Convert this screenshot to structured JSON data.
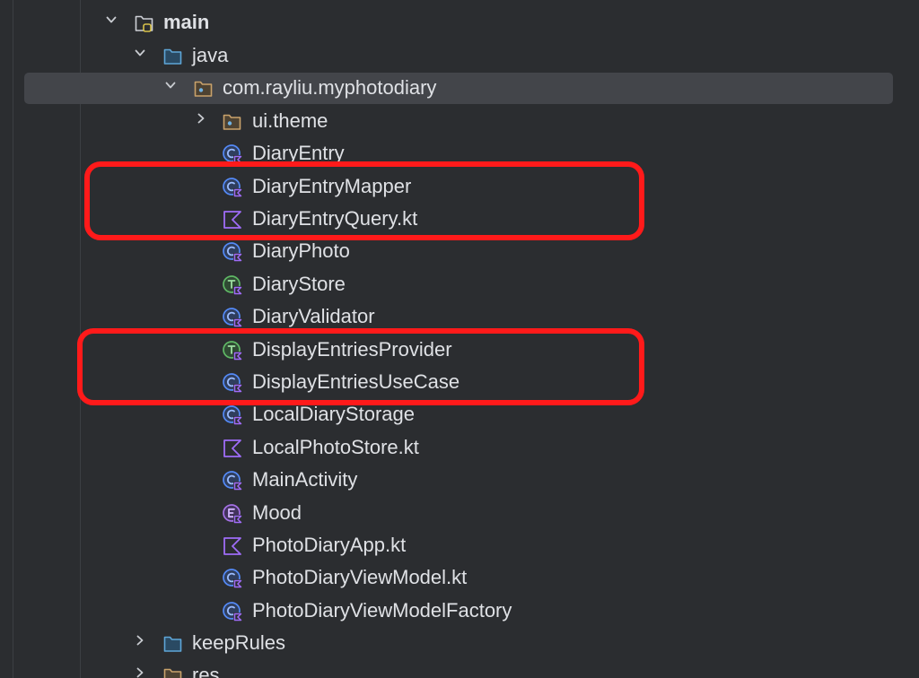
{
  "tree": {
    "rows": [
      {
        "label": "main",
        "icon": "module-folder-icon",
        "expanded": true,
        "bold": true
      },
      {
        "label": "java",
        "icon": "source-folder-icon",
        "expanded": true
      },
      {
        "label": "com.rayliu.myphotodiary",
        "icon": "package-icon",
        "expanded": true,
        "selected": true
      },
      {
        "label": "ui.theme",
        "icon": "package-icon",
        "expanded": false
      },
      {
        "label": "DiaryEntry",
        "icon": "kotlin-class-icon"
      },
      {
        "label": "DiaryEntryMapper",
        "icon": "kotlin-class-icon"
      },
      {
        "label": "DiaryEntryQuery.kt",
        "icon": "kotlin-file-icon"
      },
      {
        "label": "DiaryPhoto",
        "icon": "kotlin-class-icon"
      },
      {
        "label": "DiaryStore",
        "icon": "kotlin-interface-icon"
      },
      {
        "label": "DiaryValidator",
        "icon": "kotlin-class-icon"
      },
      {
        "label": "DisplayEntriesProvider",
        "icon": "kotlin-interface-icon"
      },
      {
        "label": "DisplayEntriesUseCase",
        "icon": "kotlin-class-icon"
      },
      {
        "label": "LocalDiaryStorage",
        "icon": "kotlin-class-icon"
      },
      {
        "label": "LocalPhotoStore.kt",
        "icon": "kotlin-file-icon"
      },
      {
        "label": "MainActivity",
        "icon": "kotlin-class-icon"
      },
      {
        "label": "Mood",
        "icon": "kotlin-enum-icon"
      },
      {
        "label": "PhotoDiaryApp.kt",
        "icon": "kotlin-file-icon"
      },
      {
        "label": "PhotoDiaryViewModel.kt",
        "icon": "kotlin-class-icon"
      },
      {
        "label": "PhotoDiaryViewModelFactory",
        "icon": "kotlin-class-icon"
      },
      {
        "label": "keepRules",
        "icon": "source-folder-icon",
        "expanded": false
      },
      {
        "label": "res",
        "icon": "resource-folder-icon",
        "expanded": false
      }
    ]
  },
  "colors": {
    "background": "#2b2d30",
    "selection": "#43454a",
    "text": "#dfe1e5",
    "highlight_annotation": "#ff1a1a",
    "class_icon": "#548af7",
    "interface_icon": "#5fb865",
    "enum_icon": "#a571e6",
    "kotlin_file_icon": "#9f6cf7",
    "folder_source": "#5ea6d8",
    "folder_package": "#c9a26b"
  }
}
